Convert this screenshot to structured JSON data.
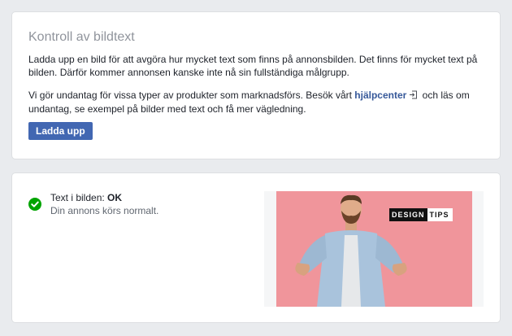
{
  "caption_check": {
    "title": "Kontroll av bildtext",
    "paragraph1": "Ladda upp en bild för att avgöra hur mycket text som finns på annonsbilden. Det finns för mycket text på bilden. Därför kommer annonsen kanske inte nå sin fullständiga målgrupp.",
    "paragraph2_before": "Vi gör undantag för vissa typer av produkter som marknadsförs. Besök vårt ",
    "help_link": "hjälpcenter",
    "paragraph2_after": " och läs om undantag, se exempel på bilder med text och få mer vägledning.",
    "upload_button": "Ladda upp",
    "link_icon": "external-link-icon"
  },
  "result": {
    "status_label": "Text i bilden: ",
    "status_value": "OK",
    "status_detail": "Din annons körs normalt.",
    "status_icon": "check-circle-icon",
    "status_color": "#00a400",
    "preview": {
      "badge_left": "DESIGN",
      "badge_right": "TIPS",
      "background_color": "#f0959b"
    }
  }
}
